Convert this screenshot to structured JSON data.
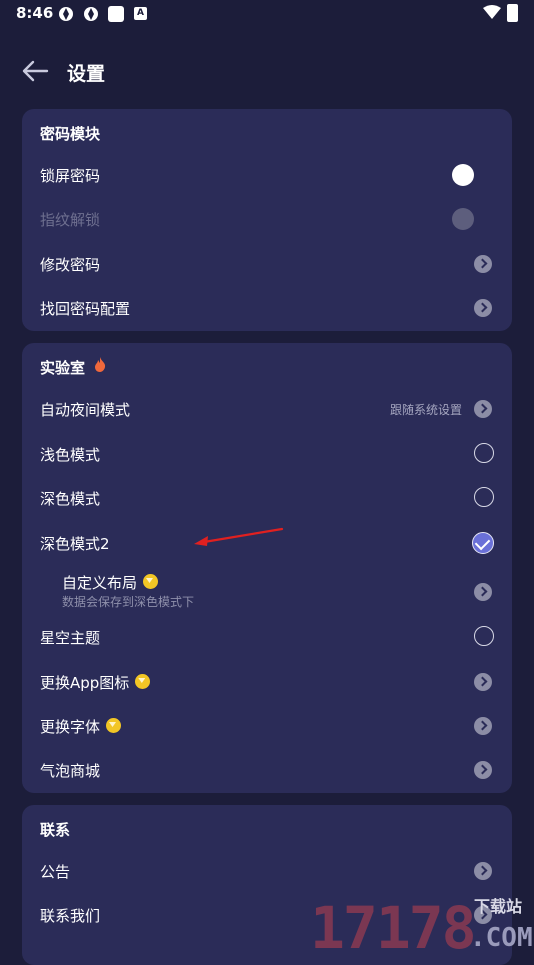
{
  "status_bar": {
    "time": "8:46",
    "badge": "A"
  },
  "header": {
    "title": "设置"
  },
  "password_section": {
    "title": "密码模块",
    "items": [
      {
        "label": "锁屏密码"
      },
      {
        "label": "指纹解锁"
      },
      {
        "label": "修改密码"
      },
      {
        "label": "找回密码配置"
      }
    ]
  },
  "lab_section": {
    "title": "实验室",
    "items": [
      {
        "label": "自动夜间模式",
        "value": "跟随系统设置"
      },
      {
        "label": "浅色模式"
      },
      {
        "label": "深色模式"
      },
      {
        "label": "深色模式2"
      },
      {
        "label": "自定义布局",
        "desc": "数据会保存到深色模式下"
      },
      {
        "label": "星空主题"
      },
      {
        "label": "更换App图标"
      },
      {
        "label": "更换字体"
      },
      {
        "label": "气泡商城"
      }
    ]
  },
  "contact_section": {
    "title": "联系",
    "items": [
      {
        "label": "公告"
      },
      {
        "label": "联系我们"
      }
    ]
  },
  "watermark": {
    "text_big": "17178",
    "text_sub": "下载站",
    "text_com": ".COM"
  },
  "colors": {
    "background": "#1c1d3a",
    "card": "#2b2c58",
    "accent": "#6a70d8",
    "gem": "#f2c625",
    "annotation_arrow": "#e02020"
  }
}
